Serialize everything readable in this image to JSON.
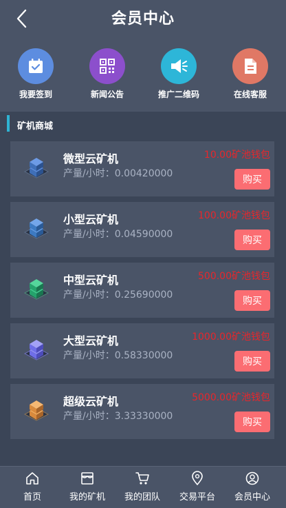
{
  "header": {
    "title": "会员中心"
  },
  "quick_actions": [
    {
      "label": "我要签到",
      "icon": "calendar-check-icon",
      "color": "#5d8de0"
    },
    {
      "label": "新闻公告",
      "icon": "qr-code-icon",
      "color": "#8c4fcc"
    },
    {
      "label": "推广二维码",
      "icon": "megaphone-icon",
      "color": "#2db6d8"
    },
    {
      "label": "在线客服",
      "icon": "document-icon",
      "color": "#e07865"
    }
  ],
  "section": {
    "title": "矿机商城"
  },
  "miners": [
    {
      "name": "微型云矿机",
      "rate": "产量/小时：0.00420000",
      "price": "10.00矿池钱包",
      "buy_label": "购买",
      "icon": "server-stack-icon",
      "color": "#3f6fb8"
    },
    {
      "name": "小型云矿机",
      "rate": "产量/小时：0.04590000",
      "price": "100.00矿池钱包",
      "buy_label": "购买",
      "icon": "server-stack-icon",
      "color": "#3d7ac2"
    },
    {
      "name": "中型云矿机",
      "rate": "产量/小时：0.25690000",
      "price": "500.00矿池钱包",
      "buy_label": "购买",
      "icon": "server-stack-icon",
      "color": "#25a36c"
    },
    {
      "name": "大型云矿机",
      "rate": "产量/小时：0.58330000",
      "price": "1000.00矿池钱包",
      "buy_label": "购买",
      "icon": "server-stack-icon",
      "color": "#6f6ee8"
    },
    {
      "name": "超级云矿机",
      "rate": "产量/小时：3.33330000",
      "price": "5000.00矿池钱包",
      "buy_label": "购买",
      "icon": "server-stack-icon",
      "color": "#d98a3c"
    }
  ],
  "tabbar": [
    {
      "label": "首页",
      "icon": "home-icon"
    },
    {
      "label": "我的矿机",
      "icon": "store-icon"
    },
    {
      "label": "我的团队",
      "icon": "cart-icon"
    },
    {
      "label": "交易平台",
      "icon": "location-pin-icon"
    },
    {
      "label": "会员中心",
      "icon": "user-icon"
    }
  ]
}
